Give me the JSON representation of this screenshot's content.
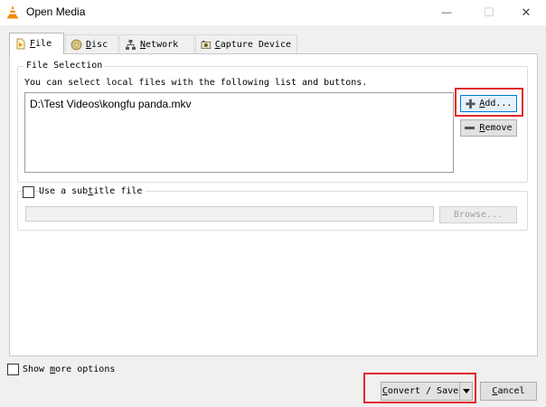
{
  "window": {
    "title": "Open Media",
    "icon": "vlc-cone-icon",
    "minimize_glyph": "—",
    "maximize_glyph": "☐",
    "close_glyph": "✕"
  },
  "tabs": [
    {
      "label": "File",
      "mnemonic": "F",
      "rest": "ile",
      "icon": "file-icon",
      "active": true
    },
    {
      "label": "Disc",
      "mnemonic": "D",
      "rest": "isc",
      "icon": "disc-icon",
      "active": false
    },
    {
      "label": "Network",
      "mnemonic": "N",
      "rest": "etwork",
      "icon": "network-icon",
      "active": false
    },
    {
      "label": "Capture Device",
      "mnemonic": "C",
      "rest": "apture Device",
      "icon": "capture-device-icon",
      "active": false
    }
  ],
  "file_selection": {
    "legend": "File Selection",
    "description": "You can select local files with the following list and buttons.",
    "files": [
      "D:\\Test Videos\\kongfu panda.mkv"
    ],
    "add_label": "Add...",
    "add_mnemonic": "A",
    "add_rest": "dd...",
    "remove_label": "Remove",
    "remove_mnemonic": "R",
    "remove_rest": "emove"
  },
  "subtitle": {
    "checkbox_label": "Use a subtitle file",
    "label_pre": "Use a sub",
    "label_mnemonic": "t",
    "label_post": "itle file",
    "checked": false,
    "value": "",
    "browse_label": "Browse..."
  },
  "footer": {
    "show_more_label": "Show more options",
    "show_more_pre": "Show ",
    "show_more_mnemonic": "m",
    "show_more_post": "ore options",
    "convert_label": "Convert / Save",
    "convert_mnemonic": "C",
    "convert_rest": "onvert / Save",
    "cancel_label": "Cancel",
    "cancel_mnemonic": "C",
    "cancel_rest": "ancel"
  },
  "colors": {
    "highlight": "#e0292b",
    "vlc_orange": "#f08a00",
    "focus_blue": "#0078d7"
  }
}
